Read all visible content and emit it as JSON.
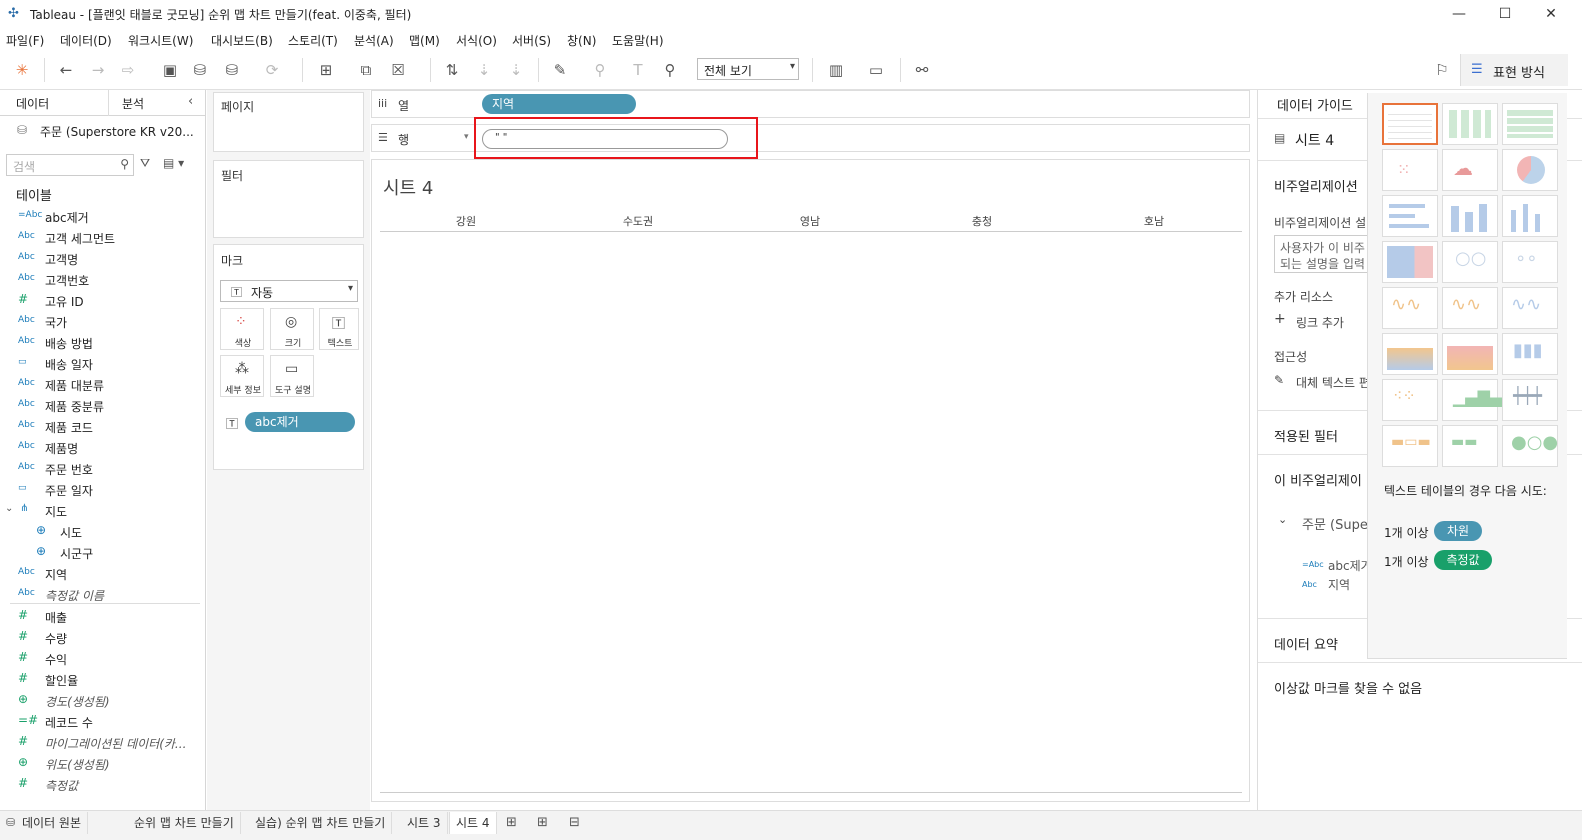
{
  "window": {
    "title": "Tableau - [플랜잇 태블로 굿모닝] 순위 맵 차트 만들기(feat. 이중축, 필터)",
    "minimize": "—",
    "maximize": "☐",
    "close": "✕"
  },
  "menu": [
    "파일(F)",
    "데이터(D)",
    "워크시트(W)",
    "대시보드(B)",
    "스토리(T)",
    "분석(A)",
    "맵(M)",
    "서식(O)",
    "서버(S)",
    "창(N)",
    "도움말(H)"
  ],
  "toolbar": {
    "view_select": "전체 보기",
    "show_me_label": "표현 방식"
  },
  "left": {
    "tab_data": "데이터",
    "tab_analysis": "분석",
    "datasource": "주문 (Superstore KR v20...",
    "search_placeholder": "검색",
    "tables_header": "테이블",
    "fields": [
      {
        "icon": "=Abc",
        "name": "abc제거",
        "italic": false
      },
      {
        "icon": "Abc",
        "name": "고객 세그먼트",
        "italic": false
      },
      {
        "icon": "Abc",
        "name": "고객명",
        "italic": false
      },
      {
        "icon": "Abc",
        "name": "고객번호",
        "italic": false
      },
      {
        "icon": "#",
        "name": "고유 ID",
        "italic": false
      },
      {
        "icon": "Abc",
        "name": "국가",
        "italic": false
      },
      {
        "icon": "Abc",
        "name": "배송 방법",
        "italic": false
      },
      {
        "icon": "cal",
        "name": "배송 일자",
        "italic": false
      },
      {
        "icon": "Abc",
        "name": "제품 대분류",
        "italic": false
      },
      {
        "icon": "Abc",
        "name": "제품 중분류",
        "italic": false
      },
      {
        "icon": "Abc",
        "name": "제품 코드",
        "italic": false
      },
      {
        "icon": "Abc",
        "name": "제품명",
        "italic": false
      },
      {
        "icon": "Abc",
        "name": "주문 번호",
        "italic": false
      },
      {
        "icon": "cal",
        "name": "주문 일자",
        "italic": false
      }
    ],
    "geo_group": "지도",
    "geo_items": [
      "시도",
      "시군구"
    ],
    "dims_after": [
      {
        "icon": "Abc",
        "name": "지역",
        "italic": false
      },
      {
        "icon": "Abc",
        "name": "측정값 이름",
        "italic": true
      }
    ],
    "measures": [
      {
        "icon": "#",
        "name": "매출",
        "italic": false
      },
      {
        "icon": "#",
        "name": "수량",
        "italic": false
      },
      {
        "icon": "#",
        "name": "수익",
        "italic": false
      },
      {
        "icon": "#",
        "name": "할인율",
        "italic": false
      },
      {
        "icon": "globe",
        "name": "경도(생성됨)",
        "italic": true
      },
      {
        "icon": "=#",
        "name": "레코드 수",
        "italic": false
      },
      {
        "icon": "#",
        "name": "마이그레이션된 데이터(카...",
        "italic": true
      },
      {
        "icon": "globe",
        "name": "위도(생성됨)",
        "italic": true
      },
      {
        "icon": "#",
        "name": "측정값",
        "italic": true
      }
    ]
  },
  "cards": {
    "pages": "페이지",
    "filters": "필터",
    "marks": "마크",
    "marks_type": "자동",
    "mark_buttons": [
      "색상",
      "크기",
      "텍스트",
      "세부 정보",
      "도구 설명"
    ],
    "text_pill": "abc제거"
  },
  "shelves": {
    "columns_label": "열",
    "rows_label": "행",
    "columns_pill": "지역",
    "rows_pill": "\" \""
  },
  "sheet": {
    "title": "시트 4",
    "headers": [
      "강원",
      "수도권",
      "영남",
      "충청",
      "호남"
    ]
  },
  "guide": {
    "header": "데이터 가이드",
    "sheet_name": "시트 4",
    "viz_desc_title": "비주얼리제이션",
    "viz_desc_label": "비주얼리제이션 설",
    "viz_desc_placeholder_1": "사용자가 이 비주",
    "viz_desc_placeholder_2": "되는 설명을 입력",
    "resources": "추가 리소스",
    "add_link": "링크 추가",
    "accessibility": "접근성",
    "alt_text": "대체 텍스트 편",
    "applied_filters": "적용된 필터",
    "this_viz": "이 비주얼리제이",
    "ds_name": "주문 (Supe",
    "ds_field_1": "abc제거",
    "ds_field_2": "지역",
    "data_summary": "데이터 요약",
    "outliers": "이상값 마크를 찾을 수 없음"
  },
  "showme": {
    "hint": "텍스트 테이블의 경우 다음 시도:",
    "req1_prefix": "1개 이상",
    "req1_tag": "차원",
    "req2_prefix": "1개 이상",
    "req2_tag": "측정값"
  },
  "bottom_tabs": [
    "데이터 원본",
    "순위 맵 차트 만들기",
    "실습) 순위 맵 차트 만들기",
    "시트 3",
    "시트 4"
  ],
  "colors": {
    "pill_blue": "#4996b2",
    "measure_green": "#19a06a",
    "highlight_red": "#e8151b"
  }
}
